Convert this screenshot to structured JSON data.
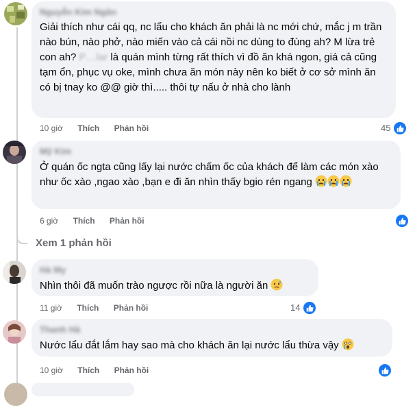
{
  "comments": [
    {
      "author": "Nguyễn Kim Ngân",
      "text_part1": "Giải thích như cái qq, nc lẩu cho khách ăn phải là nc mới chứ, mắc j m trần nào bún, nào phở, nào miến vào cả cái nồi nc dùng to đùng ah? M lừa trẻ con ah? ",
      "blurred_name": "P…lar",
      "text_part2": " là quán mình từng rất thích vì đồ ăn khá ngon, giá cả cũng tạm ổn, phục vụ oke, mình chưa ăn món này nên ko biết ở cơ sở mình ăn có bị tnay ko @@ giờ thì..... thôi tự nấu ở nhà cho lành",
      "time": "10 giờ",
      "like": "Thích",
      "reply": "Phản hồi",
      "reaction_count": "45"
    },
    {
      "author": "Mỹ Kim",
      "text": "Ở quán ốc ngta cũng lấy lại nước chấm ốc của khách để làm các món xào như ốc xào ,ngao xào ,bạn e đi ăn nhìn thấy bgio rén ngang",
      "time": "6 giờ",
      "like": "Thích",
      "reply": "Phản hồi",
      "view_replies": "Xem 1 phản hồi"
    },
    {
      "author": "Hà My",
      "text": "Nhìn thôi đã muốn trào ngược rồi nữa là người ăn",
      "time": "11 giờ",
      "like": "Thích",
      "reply": "Phản hồi",
      "reaction_count": "14"
    },
    {
      "author": "Thanh Hà",
      "text": "Nước lẩu đắt lắm hay sao mà cho khách ăn lại nước lẩu thừa vậy",
      "time": "10 giờ",
      "like": "Thích",
      "reply": "Phản hồi"
    }
  ],
  "colors": {
    "bubble": "#f0f2f5",
    "like_blue": "#1877f2",
    "meta_text": "#65676b"
  },
  "icons": [
    "like-icon",
    "crying-face-icon",
    "sad-sweat-face-icon",
    "shocked-face-icon"
  ]
}
